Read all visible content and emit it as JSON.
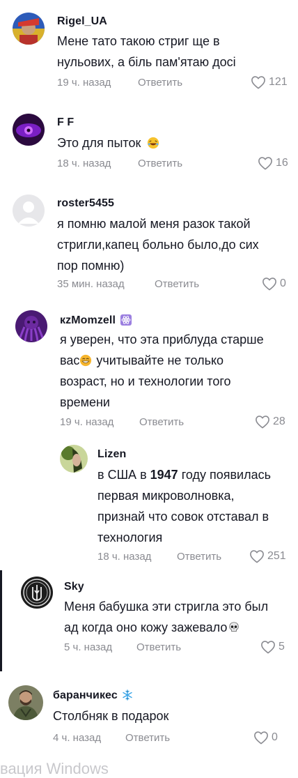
{
  "comments": [
    {
      "username": "Rigel_UA",
      "line1": "Мене тато такою стриг ще в",
      "line2": "нульових, а біль пам'ятаю досі",
      "time": "19 ч. назад",
      "reply": "Ответить",
      "likes": "121"
    },
    {
      "username": "F F",
      "line1": "Это для пыток",
      "time": "18 ч. назад",
      "reply": "Ответить",
      "likes": "16"
    },
    {
      "username": "roster5455",
      "line1": "я помню малой меня разок такой",
      "line2": "стригли,капец больно было,до сих",
      "line3": "пор помню)",
      "time": "35 мин. назад",
      "reply": "Ответить",
      "likes": "0"
    },
    {
      "username": "кzMomzell",
      "line1": "я уверен, что эта приблуда старше",
      "line2a": "вас",
      "line2b": "учитывайте не только",
      "line3": "возраст, но и технологии того",
      "line4": "времени",
      "time": "19 ч. назад",
      "reply": "Ответить",
      "likes": "28"
    },
    {
      "username": "Lizen",
      "line1a": "в США в ",
      "line1b": "1947",
      "line1c": " году появилась",
      "line2": "первая микроволновка,",
      "line3": "признай что совок отставал в",
      "line4": "технология",
      "time": "18 ч. назад",
      "reply": "Ответить",
      "likes": "251"
    },
    {
      "username": "Sky",
      "line1": "Меня бабушка эти стригла это был",
      "line2": "ад когда оно кожу зажевало",
      "time": "5 ч. назад",
      "reply": "Ответить",
      "likes": "5"
    },
    {
      "username": "баранчикес",
      "line1": "Столбняк в подарок",
      "time": "4 ч. назад",
      "reply": "Ответить",
      "likes": "0"
    }
  ],
  "watermark": "вация Windows",
  "icons": {
    "like": "heart-outline-icon",
    "laugh": "laughing-emoji",
    "smile": "smiling-emoji",
    "skull": "skull-emoji",
    "badge": "atom-badge-icon",
    "snowflake": "snowflake-icon"
  },
  "colors": {
    "text": "#161823",
    "muted": "#8a8b91"
  }
}
